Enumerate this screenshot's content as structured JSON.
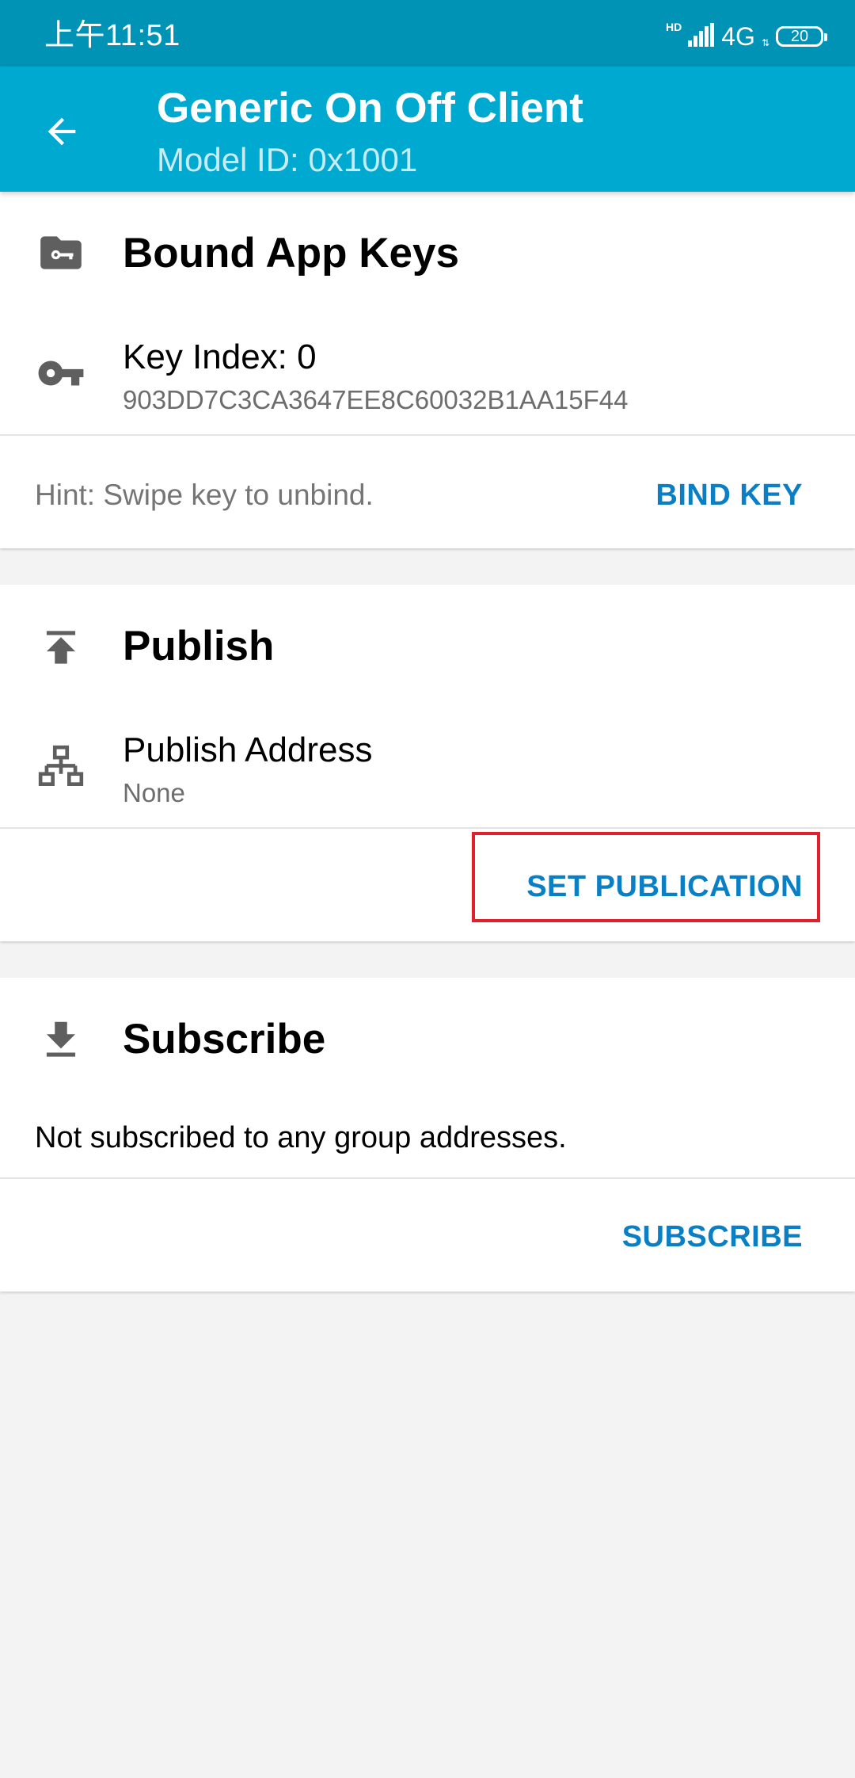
{
  "status_bar": {
    "time": "上午11:51",
    "hd_label": "HD",
    "network": "4G",
    "battery_level": "20"
  },
  "app_bar": {
    "title": "Generic On Off Client",
    "subtitle": "Model ID: 0x1001"
  },
  "bound_app_keys": {
    "title": "Bound App Keys",
    "key": {
      "title": "Key Index: 0",
      "value": "903DD7C3CA3647EE8C60032B1AA15F44"
    },
    "hint": "Hint: Swipe key to unbind.",
    "action_label": "BIND KEY"
  },
  "publish": {
    "title": "Publish",
    "address_title": "Publish Address",
    "address_value": "None",
    "action_label": "SET PUBLICATION"
  },
  "subscribe": {
    "title": "Subscribe",
    "empty_text": "Not subscribed to any group addresses.",
    "action_label": "SUBSCRIBE"
  },
  "colors": {
    "status_bar": "#0093b5",
    "app_bar": "#00a9cf",
    "accent_button": "#0a7fc4",
    "highlight": "#e0202c",
    "background": "#f3f3f3"
  }
}
